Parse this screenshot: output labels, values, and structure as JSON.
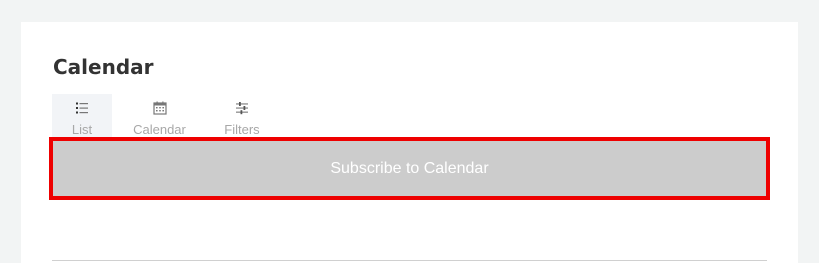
{
  "page": {
    "title": "Calendar"
  },
  "view_tabs": [
    {
      "label": "List",
      "icon": "list-icon",
      "active": true
    },
    {
      "label": "Calendar",
      "icon": "calendar-icon",
      "active": false
    },
    {
      "label": "Filters",
      "icon": "sliders-icon",
      "active": false
    }
  ],
  "subscribe": {
    "label": "Subscribe to Calendar"
  },
  "colors": {
    "background": "#f2f4f4",
    "card": "#ffffff",
    "button": "#cccccc",
    "highlight_border": "#ee0000",
    "active_tab": "#f2f4f7"
  }
}
